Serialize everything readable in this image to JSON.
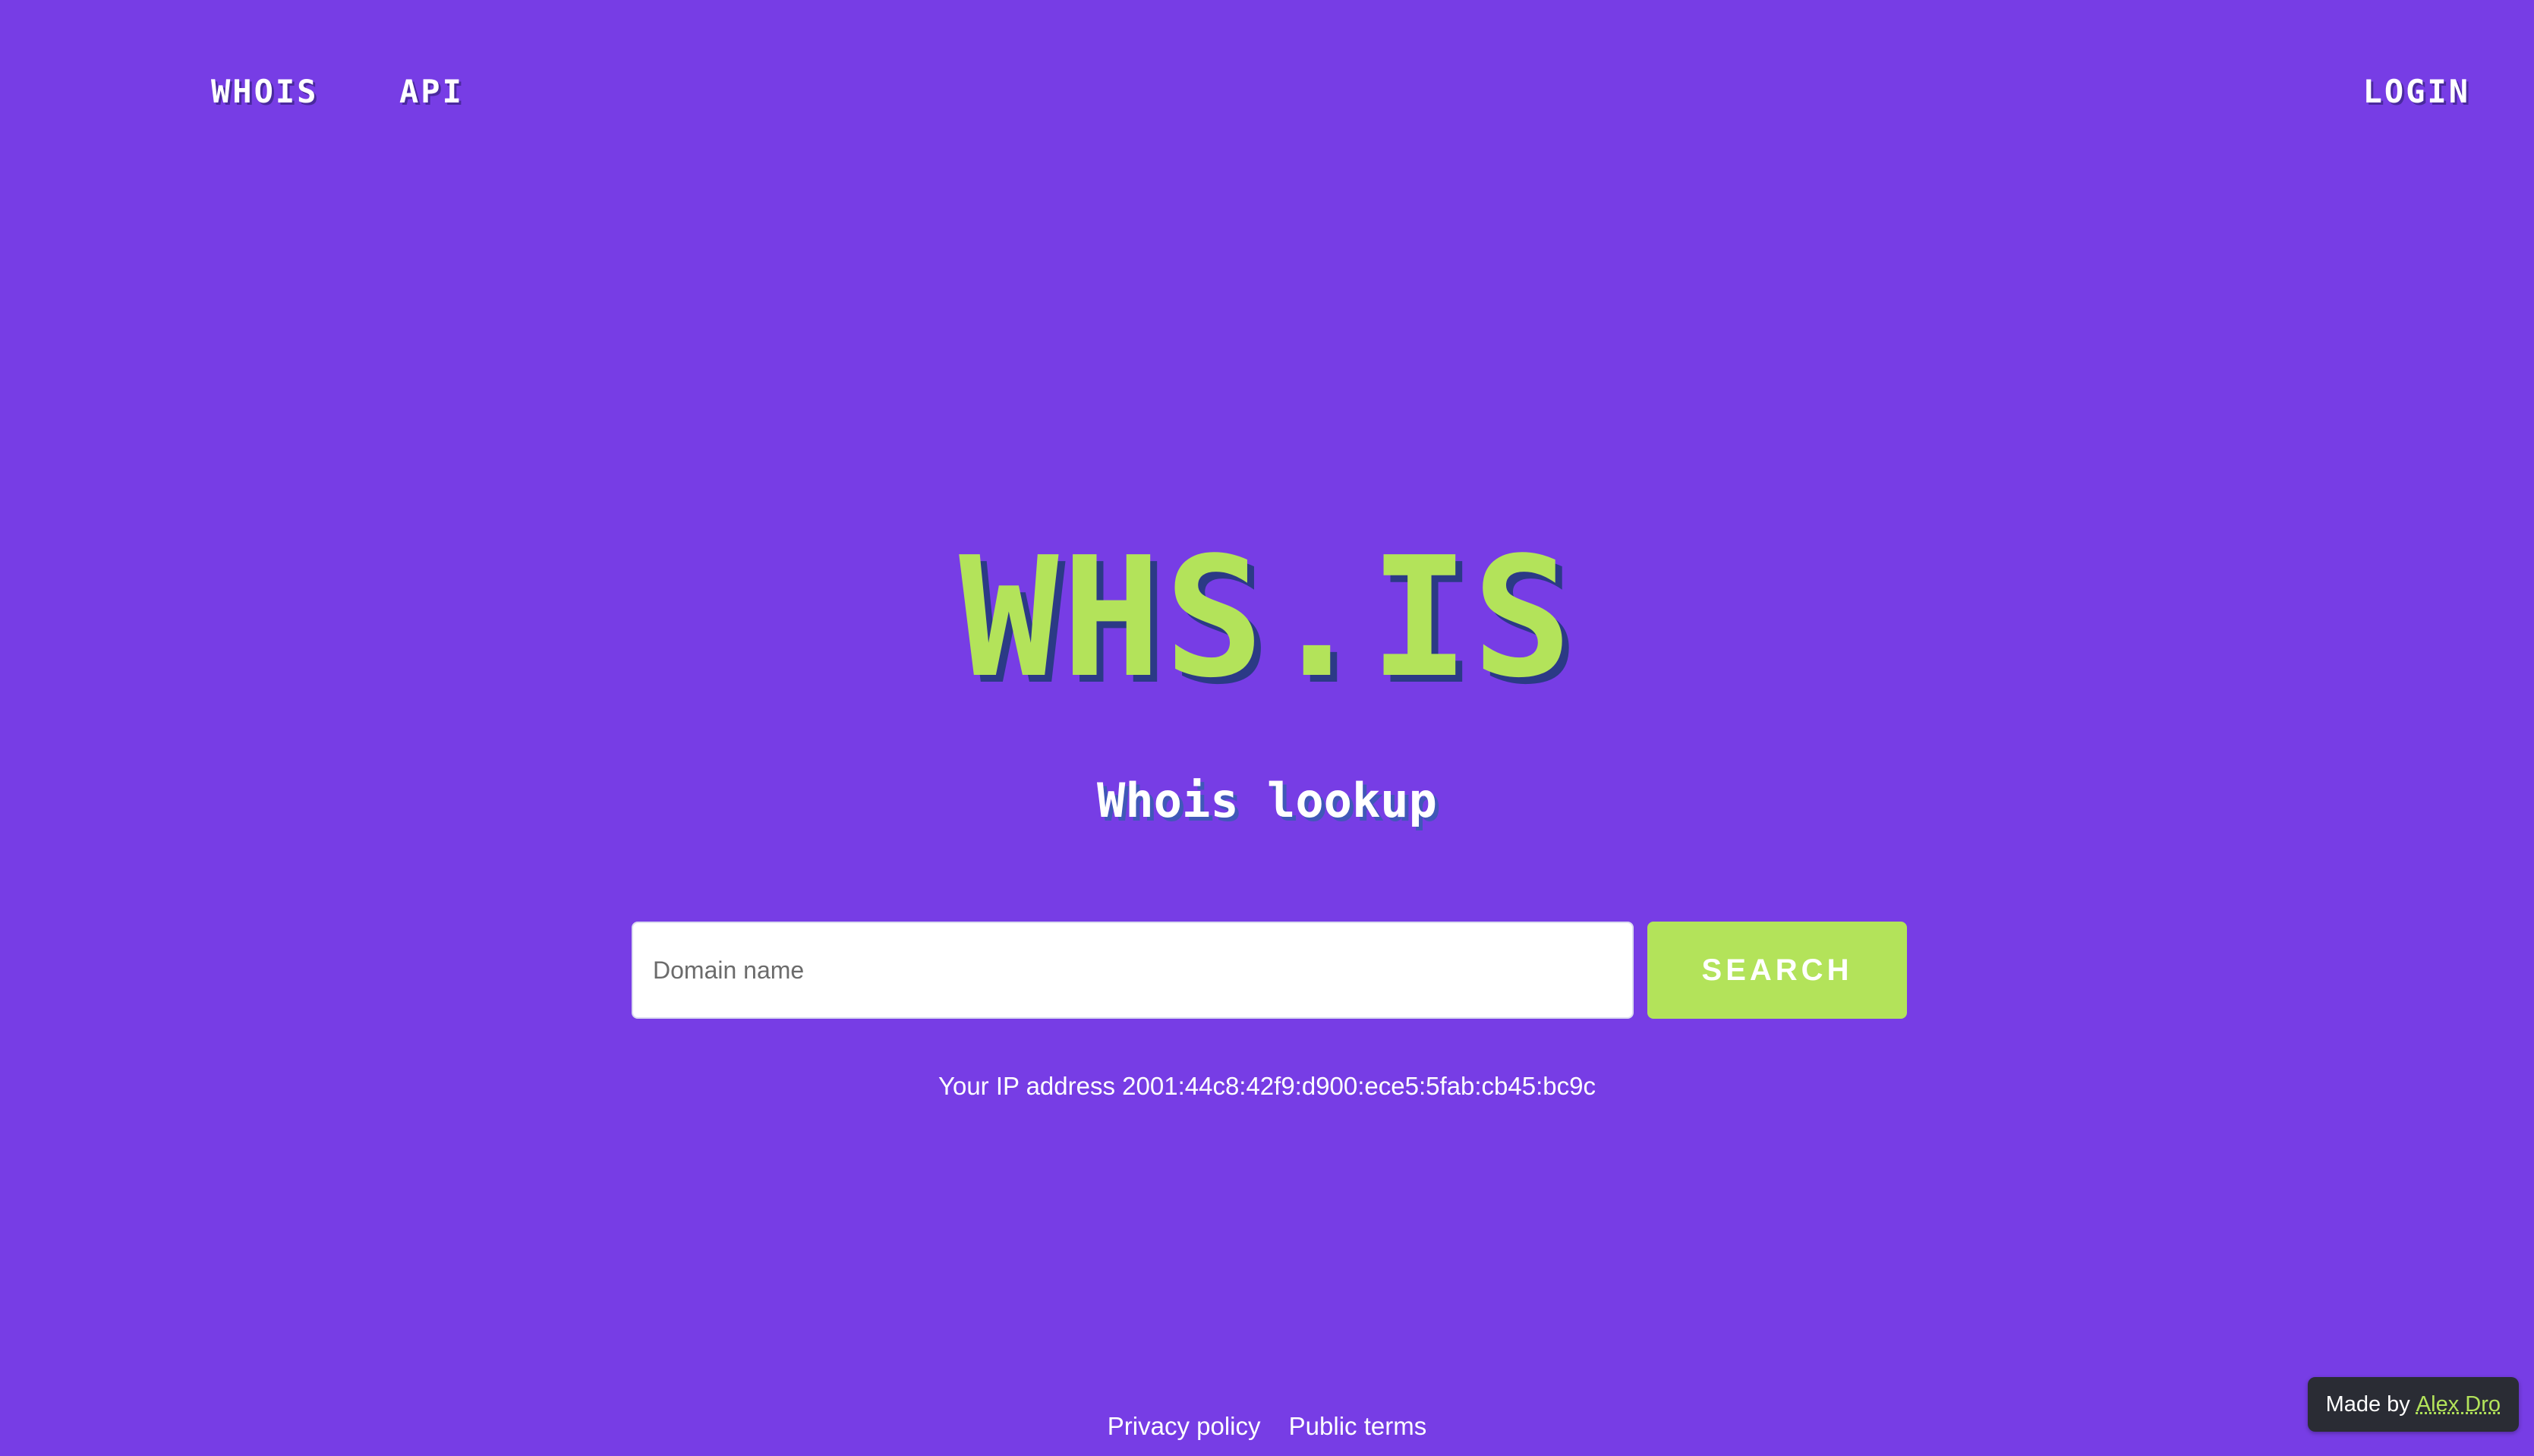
{
  "nav": {
    "whois_label": "WHOIS",
    "api_label": "API",
    "login_label": "LOGIN"
  },
  "hero": {
    "logo_text": "WHS.IS",
    "subtitle": "Whois lookup"
  },
  "search": {
    "placeholder": "Domain name",
    "value": "",
    "button_label": "SEARCH"
  },
  "ip": {
    "text": "Your IP address 2001:44c8:42f9:d900:ece5:5fab:cb45:bc9c"
  },
  "footer": {
    "privacy_label": "Privacy policy",
    "terms_label": "Public terms"
  },
  "badge": {
    "prefix": "Made by",
    "author": "Alex Dro"
  },
  "colors": {
    "background": "#773de5",
    "accent": "#b3e35a",
    "badge_bg": "#2a2c34"
  }
}
